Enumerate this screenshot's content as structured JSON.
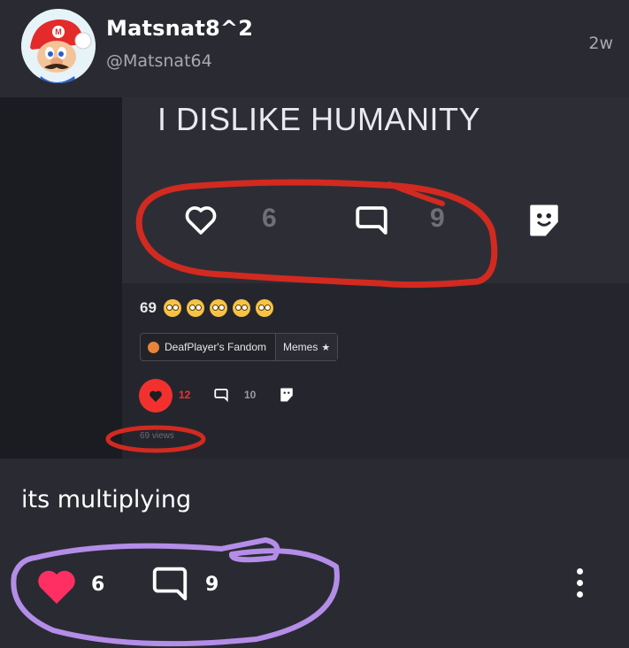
{
  "post": {
    "author": {
      "display_name": "Matsnat8^2",
      "handle": "@Matsnat64"
    },
    "timestamp": "2w",
    "caption": "its multiplying",
    "like_count": "6",
    "comment_count": "9"
  },
  "embedded": {
    "title": "I DISLIKE HUMANITY",
    "like_count": "6",
    "comment_count": "9",
    "reaction_count": "69",
    "fandom_tag": "DeafPlayer's Fandom",
    "category_tag": "Memes",
    "small_like_count": "12",
    "small_comment_count": "10",
    "views": "69 views"
  },
  "colors": {
    "background": "#2a2b32",
    "like_pink": "#ff2e63",
    "annotation_red": "#d22a20",
    "annotation_purple": "#b48de8"
  },
  "icons": [
    "avatar-mario",
    "heart-icon",
    "comment-icon",
    "sticker-icon",
    "flushed-emoji-icon",
    "star-icon",
    "more-vertical-icon"
  ]
}
